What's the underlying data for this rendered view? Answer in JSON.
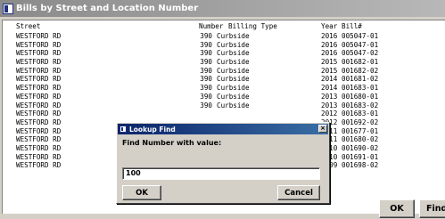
{
  "window": {
    "title": "Bills by Street and Location Number"
  },
  "list": {
    "headers": {
      "street": "Street",
      "number": "Number",
      "type": "Billing Type",
      "year": "Year",
      "bill": "Bill#"
    },
    "rows": [
      {
        "street": "WESTFORD RD",
        "number": "390",
        "type": "Curbside",
        "year": "2016",
        "bill": "005047-01"
      },
      {
        "street": "WESTFORD RD",
        "number": "390",
        "type": "Curbside",
        "year": "2016",
        "bill": "005047-01"
      },
      {
        "street": "WESTFORD RD",
        "number": "390",
        "type": "Curbside",
        "year": "2016",
        "bill": "005047-02"
      },
      {
        "street": "WESTFORD RD",
        "number": "390",
        "type": "Curbside",
        "year": "2015",
        "bill": "001682-01"
      },
      {
        "street": "WESTFORD RD",
        "number": "390",
        "type": "Curbside",
        "year": "2015",
        "bill": "001682-02"
      },
      {
        "street": "WESTFORD RD",
        "number": "390",
        "type": "Curbside",
        "year": "2014",
        "bill": "001681-02"
      },
      {
        "street": "WESTFORD RD",
        "number": "390",
        "type": "Curbside",
        "year": "2014",
        "bill": "001683-01"
      },
      {
        "street": "WESTFORD RD",
        "number": "390",
        "type": "Curbside",
        "year": "2013",
        "bill": "001680-01"
      },
      {
        "street": "WESTFORD RD",
        "number": "390",
        "type": "Curbside",
        "year": "2013",
        "bill": "001683-02"
      },
      {
        "street": "WESTFORD RD",
        "number": "",
        "type": "",
        "year": "2012",
        "bill": "001683-01"
      },
      {
        "street": "WESTFORD RD",
        "number": "",
        "type": "",
        "year": "2012",
        "bill": "001692-02"
      },
      {
        "street": "WESTFORD RD",
        "number": "",
        "type": "",
        "year": "2011",
        "bill": "001677-01"
      },
      {
        "street": "WESTFORD RD",
        "number": "",
        "type": "",
        "year": "2011",
        "bill": "001680-02"
      },
      {
        "street": "WESTFORD RD",
        "number": "",
        "type": "",
        "year": "2010",
        "bill": "001690-02"
      },
      {
        "street": "WESTFORD RD",
        "number": "",
        "type": "",
        "year": "2010",
        "bill": "001691-01"
      },
      {
        "street": "WESTFORD RD",
        "number": "",
        "type": "",
        "year": "2009",
        "bill": "001698-02"
      }
    ]
  },
  "buttons": {
    "ok": "OK",
    "find": "Find"
  },
  "dialog": {
    "title": "Lookup Find",
    "close_glyph": "×",
    "prompt": "Find Number with value:",
    "input_value": "100",
    "ok_label": "OK",
    "cancel_label": "Cancel"
  }
}
